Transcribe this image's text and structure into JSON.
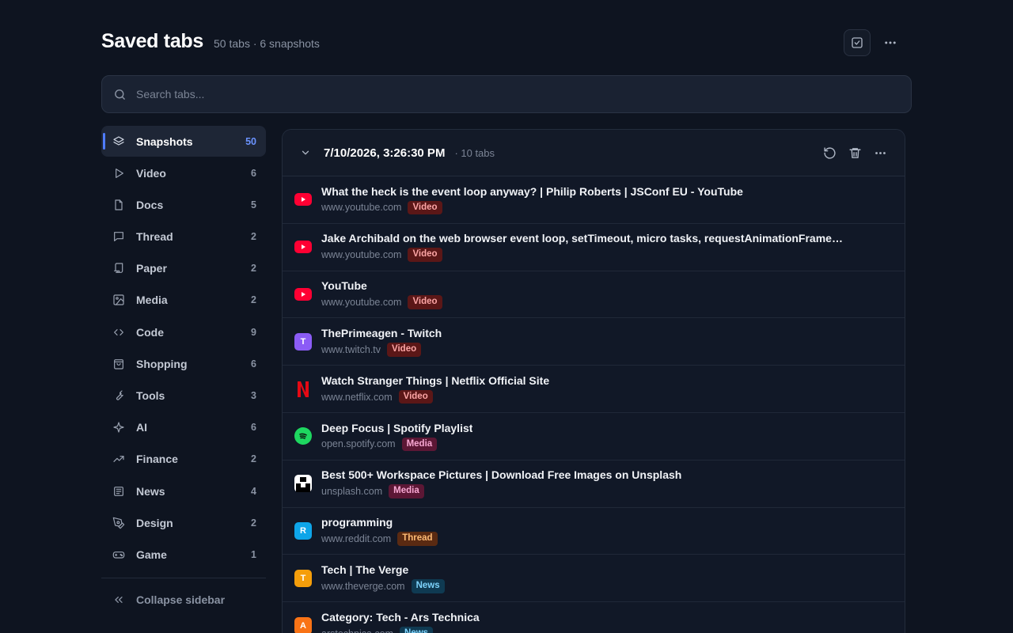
{
  "header": {
    "title": "Saved tabs",
    "subtitle": "50 tabs · 6 snapshots"
  },
  "search": {
    "placeholder": "Search tabs..."
  },
  "sidebar": {
    "items": [
      {
        "label": "Snapshots",
        "count": "50",
        "icon": "layers-icon",
        "active": true
      },
      {
        "label": "Video",
        "count": "6",
        "icon": "play-icon"
      },
      {
        "label": "Docs",
        "count": "5",
        "icon": "file-icon"
      },
      {
        "label": "Thread",
        "count": "2",
        "icon": "message-icon"
      },
      {
        "label": "Paper",
        "count": "2",
        "icon": "scroll-icon"
      },
      {
        "label": "Media",
        "count": "2",
        "icon": "image-icon"
      },
      {
        "label": "Code",
        "count": "9",
        "icon": "code-icon"
      },
      {
        "label": "Shopping",
        "count": "6",
        "icon": "shopping-bag-icon"
      },
      {
        "label": "Tools",
        "count": "3",
        "icon": "wrench-icon"
      },
      {
        "label": "AI",
        "count": "6",
        "icon": "sparkle-icon"
      },
      {
        "label": "Finance",
        "count": "2",
        "icon": "trending-up-icon"
      },
      {
        "label": "News",
        "count": "4",
        "icon": "newspaper-icon"
      },
      {
        "label": "Design",
        "count": "2",
        "icon": "pen-tool-icon"
      },
      {
        "label": "Game",
        "count": "1",
        "icon": "gamepad-icon"
      }
    ],
    "collapse_label": "Collapse sidebar"
  },
  "snapshot": {
    "title": "7/10/2026, 3:26:30 PM",
    "meta": "· 10 tabs",
    "tabs": [
      {
        "title": "What the heck is the event loop anyway? | Philip Roberts | JSConf EU - YouTube",
        "domain": "www.youtube.com",
        "tag": "Video",
        "favicon": "youtube"
      },
      {
        "title": "Jake Archibald on the web browser event loop, setTimeout, micro tasks, requestAnimationFrame,...",
        "domain": "www.youtube.com",
        "tag": "Video",
        "favicon": "youtube"
      },
      {
        "title": "YouTube",
        "domain": "www.youtube.com",
        "tag": "Video",
        "favicon": "youtube"
      },
      {
        "title": "ThePrimeagen - Twitch",
        "domain": "www.twitch.tv",
        "tag": "Video",
        "favicon": "letter",
        "letter": "T",
        "color": "#8b5cf6"
      },
      {
        "title": "Watch Stranger Things | Netflix Official Site",
        "domain": "www.netflix.com",
        "tag": "Video",
        "favicon": "netflix"
      },
      {
        "title": "Deep Focus | Spotify Playlist",
        "domain": "open.spotify.com",
        "tag": "Media",
        "favicon": "spotify"
      },
      {
        "title": "Best 500+ Workspace Pictures | Download Free Images on Unsplash",
        "domain": "unsplash.com",
        "tag": "Media",
        "favicon": "unsplash"
      },
      {
        "title": "programming",
        "domain": "www.reddit.com",
        "tag": "Thread",
        "favicon": "letter",
        "letter": "R",
        "color": "#0ea5e9"
      },
      {
        "title": "Tech | The Verge",
        "domain": "www.theverge.com",
        "tag": "News",
        "favicon": "letter",
        "letter": "T",
        "color": "#f59e0b"
      },
      {
        "title": "Category: Tech - Ars Technica",
        "domain": "arstechnica.com",
        "tag": "News",
        "favicon": "letter",
        "letter": "A",
        "color": "#f97316"
      }
    ]
  },
  "tag_styles": {
    "Video": {
      "bg": "#5b1717",
      "fg": "#fca5a5"
    },
    "Media": {
      "bg": "#5c1735",
      "fg": "#f9a8d4"
    },
    "Thread": {
      "bg": "#5a2a12",
      "fg": "#fdba74"
    },
    "News": {
      "bg": "#0f3a52",
      "fg": "#7dd3fc"
    }
  },
  "colors": {
    "accent": "#4f7cff"
  }
}
